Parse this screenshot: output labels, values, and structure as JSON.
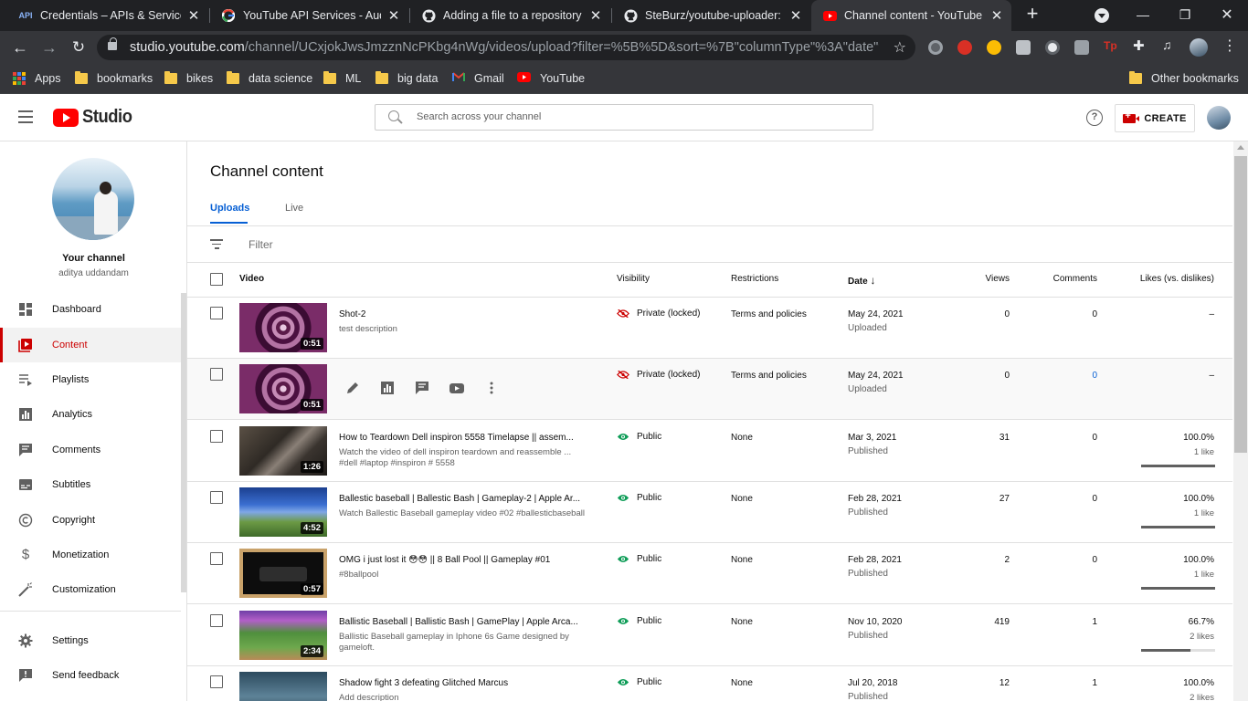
{
  "browser": {
    "tabs": [
      {
        "title": "Credentials – APIs & Services",
        "favicon": "API"
      },
      {
        "title": "YouTube API Services - Audit",
        "favicon": "google-icon"
      },
      {
        "title": "Adding a file to a repository -",
        "favicon": "github-icon"
      },
      {
        "title": "SteBurz/youtube-uploader: U",
        "favicon": "github-icon"
      },
      {
        "title": "Channel content - YouTube S",
        "favicon": "youtube-icon"
      }
    ],
    "url_host": "studio.youtube.com",
    "url_path": "/channel/UCxjokJwsJmzznNcPKbg4nWg/videos/upload?filter=%5B%5D&sort=%7B\"columnType\"%3A\"date\"%2...",
    "bookmarks": [
      "Apps",
      "bookmarks",
      "bikes",
      "data science",
      "ML",
      "big data",
      "Gmail",
      "YouTube"
    ],
    "other_bookmarks": "Other bookmarks"
  },
  "header": {
    "logo_text": "Studio",
    "search_placeholder": "Search across your channel",
    "help": "?",
    "create_label": "CREATE"
  },
  "sidebar": {
    "channel_title": "Your channel",
    "channel_name": "aditya uddandam",
    "items": [
      {
        "label": "Dashboard",
        "icon": "dashboard-icon"
      },
      {
        "label": "Content",
        "icon": "content-icon",
        "active": true
      },
      {
        "label": "Playlists",
        "icon": "playlists-icon"
      },
      {
        "label": "Analytics",
        "icon": "analytics-icon"
      },
      {
        "label": "Comments",
        "icon": "comments-icon"
      },
      {
        "label": "Subtitles",
        "icon": "subtitles-icon"
      },
      {
        "label": "Copyright",
        "icon": "copyright-icon"
      },
      {
        "label": "Monetization",
        "icon": "monetization-icon"
      },
      {
        "label": "Customization",
        "icon": "customization-icon"
      },
      {
        "label": "Settings",
        "icon": "settings-icon"
      },
      {
        "label": "Send feedback",
        "icon": "feedback-icon"
      }
    ]
  },
  "main": {
    "title": "Channel content",
    "tabs": [
      "Uploads",
      "Live"
    ],
    "filter_placeholder": "Filter",
    "columns": {
      "video": "Video",
      "visibility": "Visibility",
      "restrictions": "Restrictions",
      "date": "Date",
      "views": "Views",
      "comments": "Comments",
      "likes": "Likes (vs. dislikes)"
    },
    "rows": [
      {
        "title": "Shot-2",
        "desc": "test description",
        "duration": "0:51",
        "visibility": "Private (locked)",
        "restrictions": "Terms and policies",
        "date": "May 24, 2021",
        "date_status": "Uploaded",
        "views": "0",
        "comments": "0",
        "likes": "–",
        "likes_sub": "",
        "like_ratio": null,
        "thumb": "swirl"
      },
      {
        "title": "",
        "desc": "",
        "duration": "0:51",
        "visibility": "Private (locked)",
        "restrictions": "Terms and policies",
        "date": "May 24, 2021",
        "date_status": "Uploaded",
        "views": "0",
        "comments": "0",
        "likes": "–",
        "likes_sub": "",
        "like_ratio": null,
        "thumb": "swirl",
        "hover": true
      },
      {
        "title": "How to Teardown Dell inspiron 5558 Timelapse || assem...",
        "desc": "Watch the video of dell inspiron teardown and reassemble ... #dell #laptop #inspiron # 5558",
        "duration": "1:26",
        "visibility": "Public",
        "restrictions": "None",
        "date": "Mar 3, 2021",
        "date_status": "Published",
        "views": "31",
        "comments": "0",
        "likes": "100.0%",
        "likes_sub": "1 like",
        "like_ratio": 1.0,
        "thumb": "laptop"
      },
      {
        "title": "Ballestic baseball | Ballestic Bash | Gameplay-2 | Apple Ar...",
        "desc": "Watch Ballestic Baseball gameplay video #02 #ballesticbaseball",
        "duration": "4:52",
        "visibility": "Public",
        "restrictions": "None",
        "date": "Feb 28, 2021",
        "date_status": "Published",
        "views": "27",
        "comments": "0",
        "likes": "100.0%",
        "likes_sub": "1 like",
        "like_ratio": 1.0,
        "thumb": "baseball"
      },
      {
        "title": "OMG i just lost it 😳😳 || 8 Ball Pool || Gameplay #01",
        "desc": "#8ballpool",
        "duration": "0:57",
        "visibility": "Public",
        "restrictions": "None",
        "date": "Feb 28, 2021",
        "date_status": "Published",
        "views": "2",
        "comments": "0",
        "likes": "100.0%",
        "likes_sub": "1 like",
        "like_ratio": 1.0,
        "thumb": "pool"
      },
      {
        "title": "Ballistic Baseball | Ballistic Bash | GamePlay | Apple Arca...",
        "desc": "Ballistic Baseball gameplay in Iphone 6s Game designed by gameloft.",
        "duration": "2:34",
        "visibility": "Public",
        "restrictions": "None",
        "date": "Nov 10, 2020",
        "date_status": "Published",
        "views": "419",
        "comments": "1",
        "likes": "66.7%",
        "likes_sub": "2 likes",
        "like_ratio": 0.667,
        "thumb": "field"
      },
      {
        "title": "Shadow fight 3 defeating Glitched Marcus",
        "desc": "Add description",
        "duration": "",
        "visibility": "Public",
        "restrictions": "None",
        "date": "Jul 20, 2018",
        "date_status": "Published",
        "views": "12",
        "comments": "1",
        "likes": "100.0%",
        "likes_sub": "2 likes",
        "like_ratio": 1.0,
        "thumb": "fight"
      }
    ]
  },
  "colors": {
    "accent": "#065fd4",
    "brand_red": "#ff0000",
    "active_red": "#cc0000",
    "public_green": "#0f9d58"
  }
}
